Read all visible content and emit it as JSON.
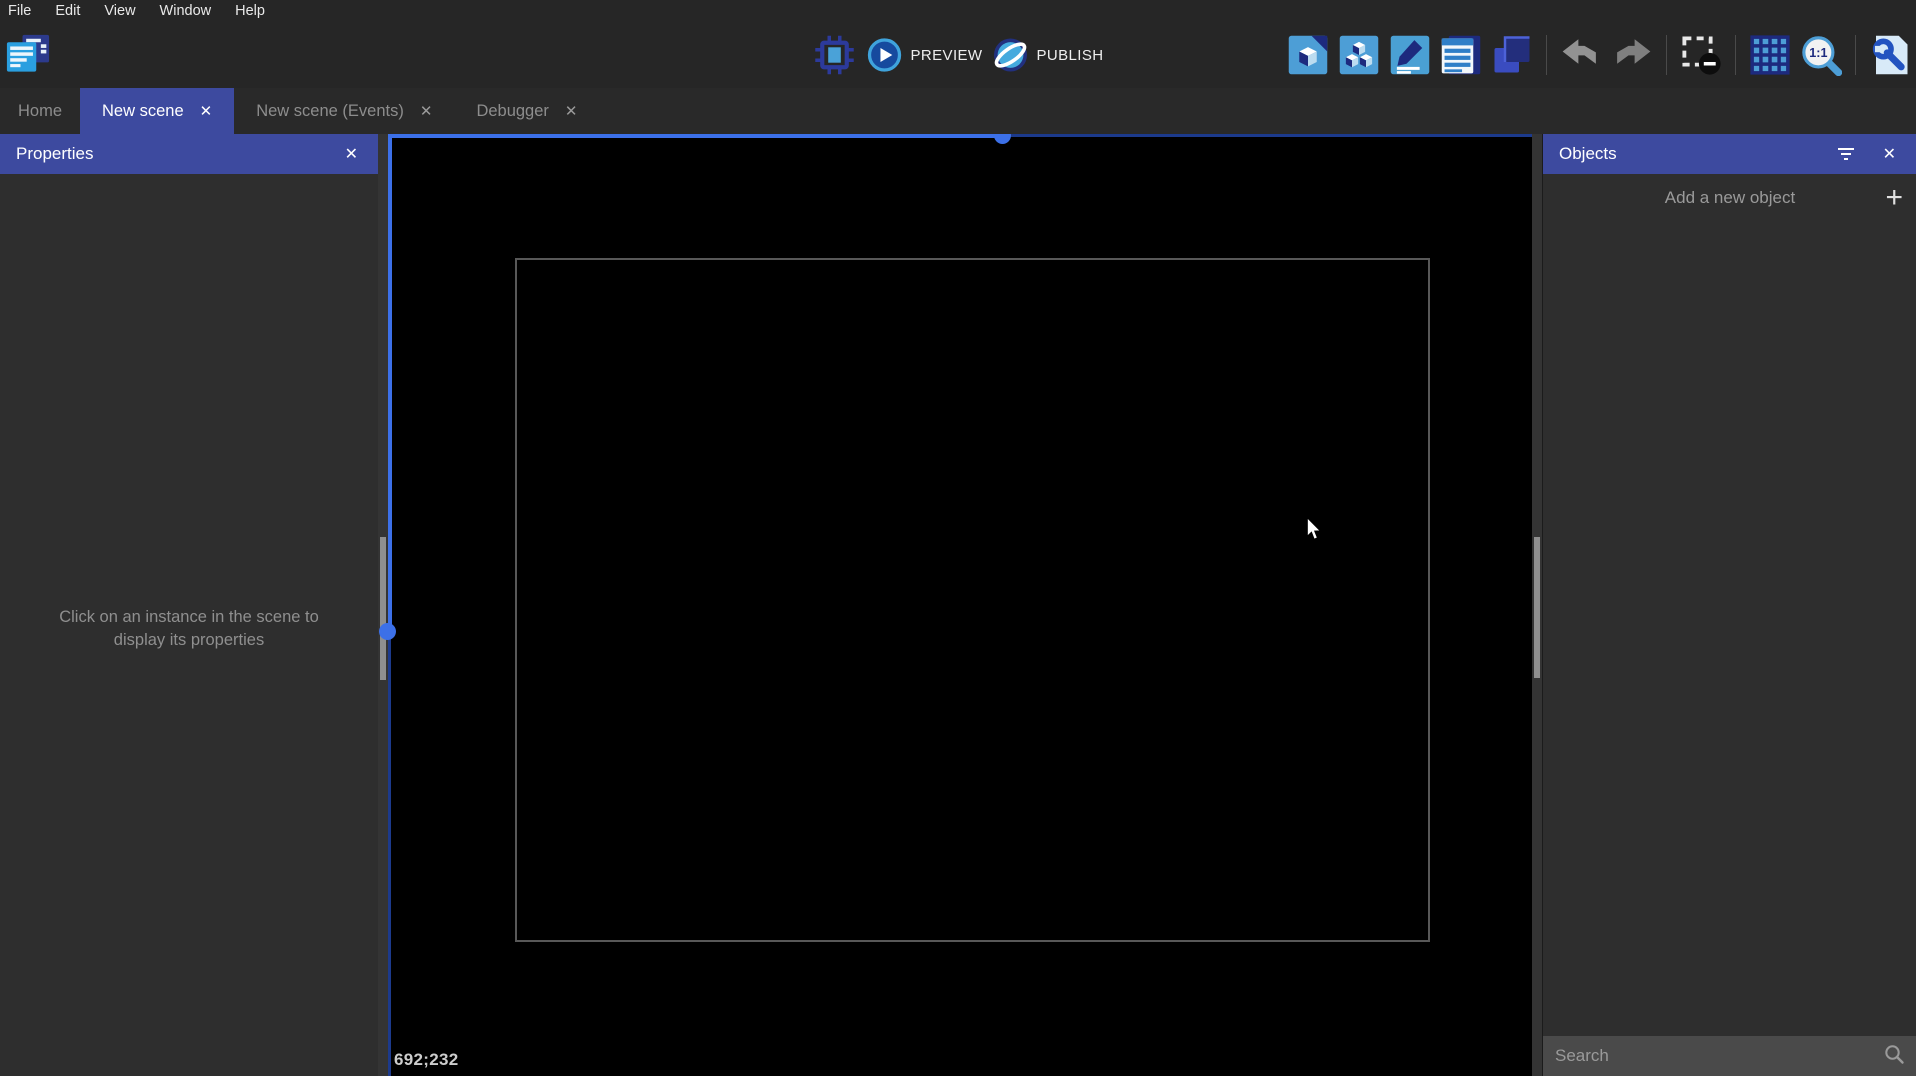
{
  "menu": {
    "items": [
      "File",
      "Edit",
      "View",
      "Window",
      "Help"
    ]
  },
  "toolbar": {
    "preview_label": "PREVIEW",
    "publish_label": "PUBLISH",
    "icons": [
      "gdevelop-project-logo",
      "debugger-chip",
      "preview-play",
      "publish-globe",
      "objects-editor",
      "instances-editor",
      "properties-pencil",
      "instances-list",
      "layers-editor",
      "undo",
      "redo",
      "delete-selection",
      "grid-setup",
      "zoom-1-1",
      "setup-wrench"
    ]
  },
  "tabs": {
    "home": "Home",
    "scene": "New scene",
    "events": "New scene (Events)",
    "debugger": "Debugger"
  },
  "glyphs": {
    "close": "✕",
    "add": "+"
  },
  "properties": {
    "title": "Properties",
    "hint": "Click on an instance in the scene to display its properties"
  },
  "objects": {
    "title": "Objects",
    "add_label": "Add a new object",
    "search_placeholder": "Search"
  },
  "canvas": {
    "coordinates": "692;232"
  },
  "colors": {
    "accent_indigo": "#3d4a9f",
    "selection_blue": "#3c70e8",
    "selection_navy": "#1c3a8c",
    "toolbar_bg": "#262626",
    "panel_bg": "#2e2e2e",
    "icon_blue": "#4d9ed6",
    "icon_navy": "#1d2a7e"
  }
}
